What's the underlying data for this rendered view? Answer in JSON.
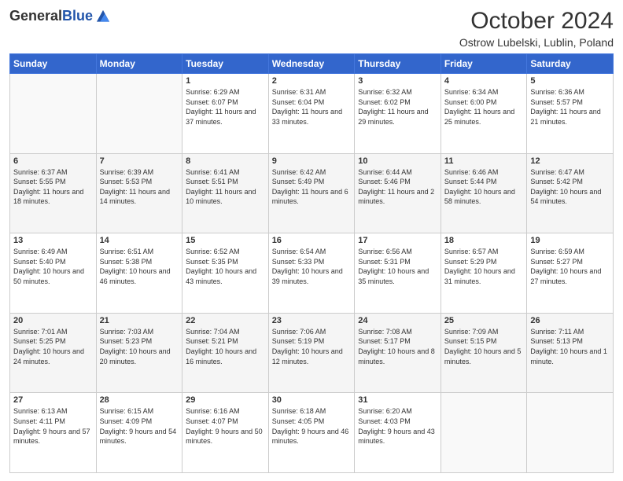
{
  "header": {
    "logo_general": "General",
    "logo_blue": "Blue",
    "month_title": "October 2024",
    "subtitle": "Ostrow Lubelski, Lublin, Poland"
  },
  "weekdays": [
    "Sunday",
    "Monday",
    "Tuesday",
    "Wednesday",
    "Thursday",
    "Friday",
    "Saturday"
  ],
  "weeks": [
    [
      {
        "day": "",
        "sunrise": "",
        "sunset": "",
        "daylight": ""
      },
      {
        "day": "",
        "sunrise": "",
        "sunset": "",
        "daylight": ""
      },
      {
        "day": "1",
        "sunrise": "Sunrise: 6:29 AM",
        "sunset": "Sunset: 6:07 PM",
        "daylight": "Daylight: 11 hours and 37 minutes."
      },
      {
        "day": "2",
        "sunrise": "Sunrise: 6:31 AM",
        "sunset": "Sunset: 6:04 PM",
        "daylight": "Daylight: 11 hours and 33 minutes."
      },
      {
        "day": "3",
        "sunrise": "Sunrise: 6:32 AM",
        "sunset": "Sunset: 6:02 PM",
        "daylight": "Daylight: 11 hours and 29 minutes."
      },
      {
        "day": "4",
        "sunrise": "Sunrise: 6:34 AM",
        "sunset": "Sunset: 6:00 PM",
        "daylight": "Daylight: 11 hours and 25 minutes."
      },
      {
        "day": "5",
        "sunrise": "Sunrise: 6:36 AM",
        "sunset": "Sunset: 5:57 PM",
        "daylight": "Daylight: 11 hours and 21 minutes."
      }
    ],
    [
      {
        "day": "6",
        "sunrise": "Sunrise: 6:37 AM",
        "sunset": "Sunset: 5:55 PM",
        "daylight": "Daylight: 11 hours and 18 minutes."
      },
      {
        "day": "7",
        "sunrise": "Sunrise: 6:39 AM",
        "sunset": "Sunset: 5:53 PM",
        "daylight": "Daylight: 11 hours and 14 minutes."
      },
      {
        "day": "8",
        "sunrise": "Sunrise: 6:41 AM",
        "sunset": "Sunset: 5:51 PM",
        "daylight": "Daylight: 11 hours and 10 minutes."
      },
      {
        "day": "9",
        "sunrise": "Sunrise: 6:42 AM",
        "sunset": "Sunset: 5:49 PM",
        "daylight": "Daylight: 11 hours and 6 minutes."
      },
      {
        "day": "10",
        "sunrise": "Sunrise: 6:44 AM",
        "sunset": "Sunset: 5:46 PM",
        "daylight": "Daylight: 11 hours and 2 minutes."
      },
      {
        "day": "11",
        "sunrise": "Sunrise: 6:46 AM",
        "sunset": "Sunset: 5:44 PM",
        "daylight": "Daylight: 10 hours and 58 minutes."
      },
      {
        "day": "12",
        "sunrise": "Sunrise: 6:47 AM",
        "sunset": "Sunset: 5:42 PM",
        "daylight": "Daylight: 10 hours and 54 minutes."
      }
    ],
    [
      {
        "day": "13",
        "sunrise": "Sunrise: 6:49 AM",
        "sunset": "Sunset: 5:40 PM",
        "daylight": "Daylight: 10 hours and 50 minutes."
      },
      {
        "day": "14",
        "sunrise": "Sunrise: 6:51 AM",
        "sunset": "Sunset: 5:38 PM",
        "daylight": "Daylight: 10 hours and 46 minutes."
      },
      {
        "day": "15",
        "sunrise": "Sunrise: 6:52 AM",
        "sunset": "Sunset: 5:35 PM",
        "daylight": "Daylight: 10 hours and 43 minutes."
      },
      {
        "day": "16",
        "sunrise": "Sunrise: 6:54 AM",
        "sunset": "Sunset: 5:33 PM",
        "daylight": "Daylight: 10 hours and 39 minutes."
      },
      {
        "day": "17",
        "sunrise": "Sunrise: 6:56 AM",
        "sunset": "Sunset: 5:31 PM",
        "daylight": "Daylight: 10 hours and 35 minutes."
      },
      {
        "day": "18",
        "sunrise": "Sunrise: 6:57 AM",
        "sunset": "Sunset: 5:29 PM",
        "daylight": "Daylight: 10 hours and 31 minutes."
      },
      {
        "day": "19",
        "sunrise": "Sunrise: 6:59 AM",
        "sunset": "Sunset: 5:27 PM",
        "daylight": "Daylight: 10 hours and 27 minutes."
      }
    ],
    [
      {
        "day": "20",
        "sunrise": "Sunrise: 7:01 AM",
        "sunset": "Sunset: 5:25 PM",
        "daylight": "Daylight: 10 hours and 24 minutes."
      },
      {
        "day": "21",
        "sunrise": "Sunrise: 7:03 AM",
        "sunset": "Sunset: 5:23 PM",
        "daylight": "Daylight: 10 hours and 20 minutes."
      },
      {
        "day": "22",
        "sunrise": "Sunrise: 7:04 AM",
        "sunset": "Sunset: 5:21 PM",
        "daylight": "Daylight: 10 hours and 16 minutes."
      },
      {
        "day": "23",
        "sunrise": "Sunrise: 7:06 AM",
        "sunset": "Sunset: 5:19 PM",
        "daylight": "Daylight: 10 hours and 12 minutes."
      },
      {
        "day": "24",
        "sunrise": "Sunrise: 7:08 AM",
        "sunset": "Sunset: 5:17 PM",
        "daylight": "Daylight: 10 hours and 8 minutes."
      },
      {
        "day": "25",
        "sunrise": "Sunrise: 7:09 AM",
        "sunset": "Sunset: 5:15 PM",
        "daylight": "Daylight: 10 hours and 5 minutes."
      },
      {
        "day": "26",
        "sunrise": "Sunrise: 7:11 AM",
        "sunset": "Sunset: 5:13 PM",
        "daylight": "Daylight: 10 hours and 1 minute."
      }
    ],
    [
      {
        "day": "27",
        "sunrise": "Sunrise: 6:13 AM",
        "sunset": "Sunset: 4:11 PM",
        "daylight": "Daylight: 9 hours and 57 minutes."
      },
      {
        "day": "28",
        "sunrise": "Sunrise: 6:15 AM",
        "sunset": "Sunset: 4:09 PM",
        "daylight": "Daylight: 9 hours and 54 minutes."
      },
      {
        "day": "29",
        "sunrise": "Sunrise: 6:16 AM",
        "sunset": "Sunset: 4:07 PM",
        "daylight": "Daylight: 9 hours and 50 minutes."
      },
      {
        "day": "30",
        "sunrise": "Sunrise: 6:18 AM",
        "sunset": "Sunset: 4:05 PM",
        "daylight": "Daylight: 9 hours and 46 minutes."
      },
      {
        "day": "31",
        "sunrise": "Sunrise: 6:20 AM",
        "sunset": "Sunset: 4:03 PM",
        "daylight": "Daylight: 9 hours and 43 minutes."
      },
      {
        "day": "",
        "sunrise": "",
        "sunset": "",
        "daylight": ""
      },
      {
        "day": "",
        "sunrise": "",
        "sunset": "",
        "daylight": ""
      }
    ]
  ]
}
